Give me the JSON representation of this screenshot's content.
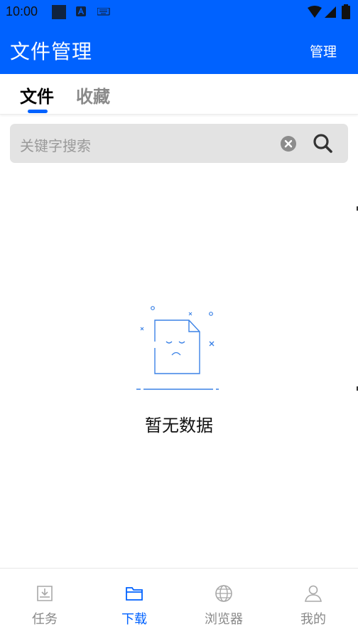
{
  "status_bar": {
    "time": "10:00",
    "icons": [
      "sim-card-icon",
      "app-notification-icon",
      "keyboard-icon",
      "wifi-icon",
      "signal-icon",
      "battery-icon"
    ]
  },
  "app_bar": {
    "title": "文件管理",
    "manage_label": "管理"
  },
  "tabs": [
    {
      "label": "文件",
      "active": true
    },
    {
      "label": "收藏",
      "active": false
    }
  ],
  "search": {
    "placeholder": "关键字搜索",
    "clear_icon": "clear-icon",
    "search_icon": "search-icon"
  },
  "empty_state": {
    "icon": "empty-document-icon",
    "message": "暂无数据"
  },
  "bottom_nav": [
    {
      "label": "任务",
      "icon": "download-tray-icon",
      "active": false
    },
    {
      "label": "下载",
      "icon": "folder-icon",
      "active": true
    },
    {
      "label": "浏览器",
      "icon": "globe-icon",
      "active": false
    },
    {
      "label": "我的",
      "icon": "user-icon",
      "active": false
    }
  ],
  "colors": {
    "primary": "#0062ff",
    "search_bg": "#e3e3e3",
    "inactive_text": "#888888"
  }
}
